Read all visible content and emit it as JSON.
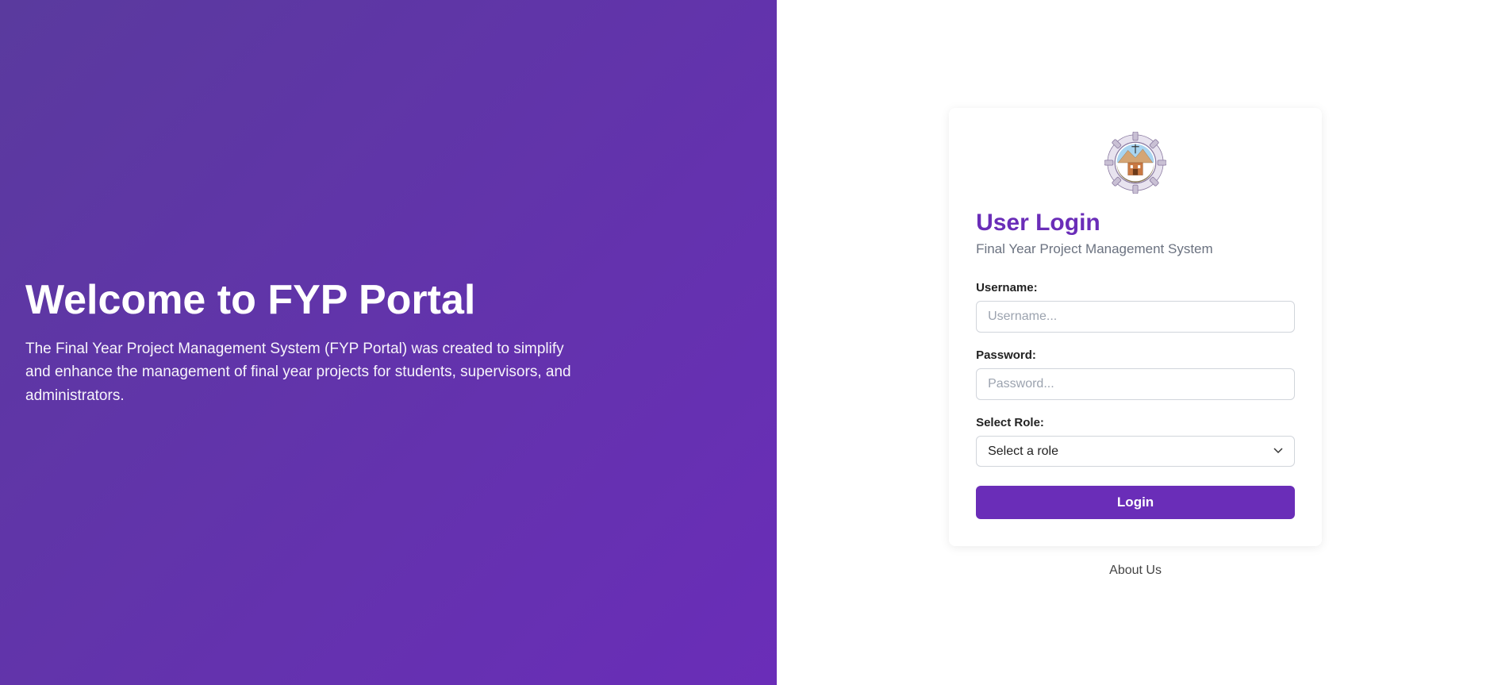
{
  "left": {
    "title": "Welcome to FYP Portal",
    "description": "The Final Year Project Management System (FYP Portal) was created to simplify and enhance the management of final year projects for students, supervisors, and administrators."
  },
  "login": {
    "logo_name": "institution-logo",
    "title": "User Login",
    "subtitle": "Final Year Project Management System",
    "username_label": "Username:",
    "username_placeholder": "Username...",
    "password_label": "Password:",
    "password_placeholder": "Password...",
    "role_label": "Select Role:",
    "role_placeholder": "Select a role",
    "button": "Login"
  },
  "footer": {
    "about": "About Us"
  },
  "colors": {
    "primary": "#6a2db8",
    "gradient_start": "#5a3a9e",
    "gradient_end": "#6a2db8"
  }
}
